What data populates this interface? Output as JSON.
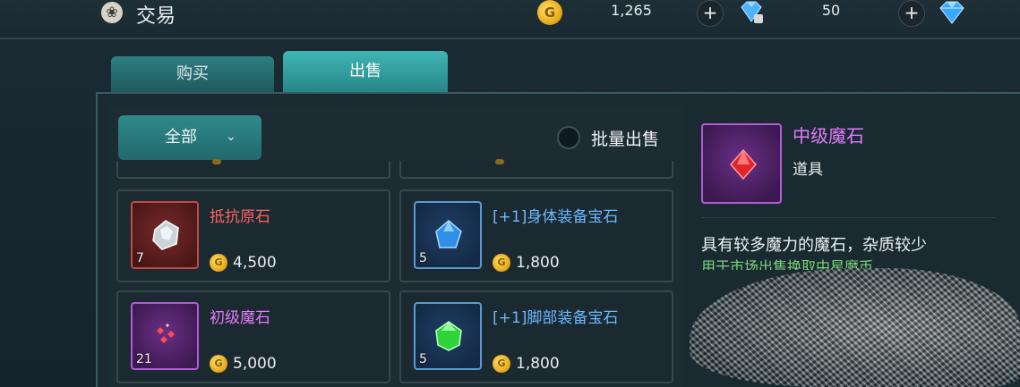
{
  "header": {
    "title": "交易",
    "title_icon": "settings-flower-icon",
    "gold": "1,265",
    "diamonds": "50",
    "plus_label": "+"
  },
  "tabs": [
    {
      "label": "购买",
      "active": false
    },
    {
      "label": "出售",
      "active": true
    }
  ],
  "filter": {
    "selected": "全部"
  },
  "batch_sell": {
    "label": "批量出售",
    "checked": false
  },
  "items": [
    {
      "name": "抵抗原石",
      "count": "7",
      "price": "4,500",
      "rarity_color": "#ff6262",
      "icon": "white-ore-icon"
    },
    {
      "name": "[+1]身体装备宝石",
      "count": "5",
      "price": "1,800",
      "rarity_color": "#6cb7ff",
      "icon": "blue-gem-icon"
    },
    {
      "name": "初级魔石",
      "count": "21",
      "price": "5,000",
      "rarity_color": "#e47aff",
      "icon": "red-shards-icon"
    },
    {
      "name": "[+1]脚部装备宝石",
      "count": "5",
      "price": "1,800",
      "rarity_color": "#6cb7ff",
      "icon": "green-gem-icon"
    }
  ],
  "detail": {
    "name": "中级魔石",
    "type": "道具",
    "description": "具有较多魔力的魔石，杂质较少",
    "usage": "用于市场出售换取中星魔币",
    "icon": "red-magic-stone-icon"
  },
  "colors": {
    "accent_teal": "#3fb5b4",
    "gold": "#e8a81a",
    "purple_rarity": "#b35ad7"
  }
}
